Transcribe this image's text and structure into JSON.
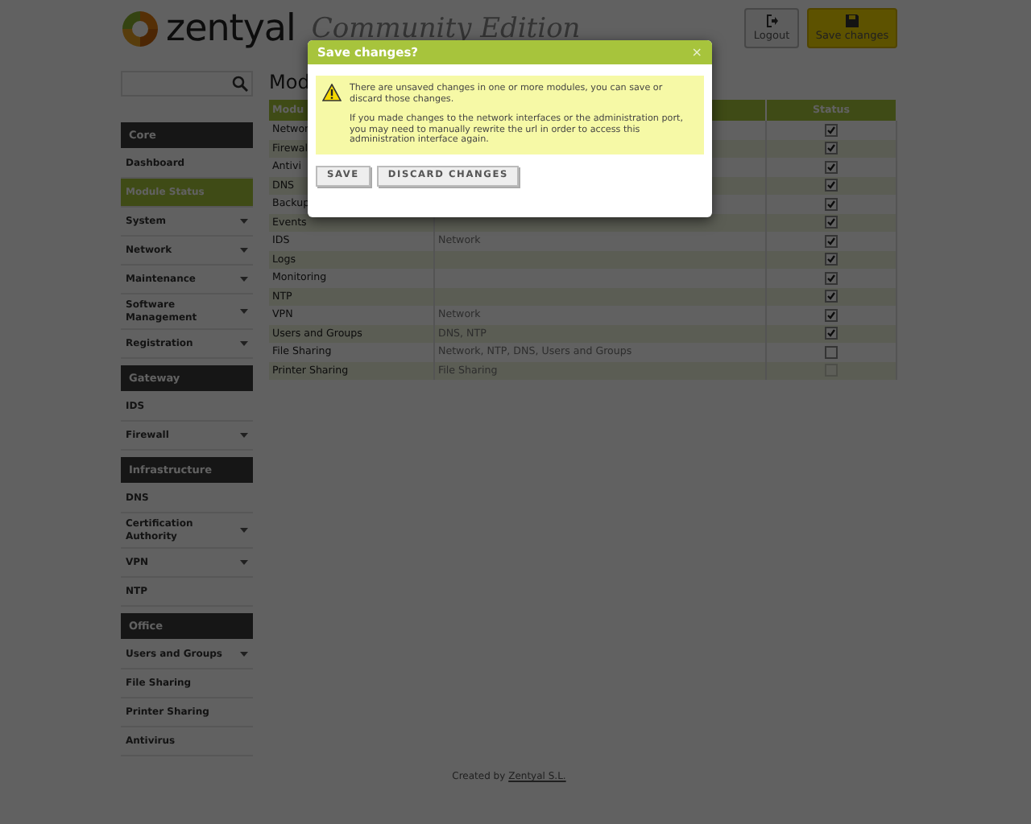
{
  "header": {
    "brand": "zentyal",
    "edition": "Community Edition",
    "buttons": [
      {
        "kind": "logout",
        "label": "Logout",
        "highlighted": false
      },
      {
        "kind": "save",
        "label": "Save changes",
        "highlighted": true
      }
    ]
  },
  "sidebar": {
    "items": [
      {
        "kind": "section",
        "label": "Core"
      },
      {
        "kind": "item",
        "label": "Dashboard",
        "selected": false,
        "expandable": false
      },
      {
        "kind": "item",
        "label": "Module Status",
        "selected": true,
        "expandable": false
      },
      {
        "kind": "item",
        "label": "System",
        "selected": false,
        "expandable": true
      },
      {
        "kind": "item",
        "label": "Network",
        "selected": false,
        "expandable": true
      },
      {
        "kind": "item",
        "label": "Maintenance",
        "selected": false,
        "expandable": true
      },
      {
        "kind": "item",
        "label": "Software Management",
        "selected": false,
        "expandable": true
      },
      {
        "kind": "item",
        "label": "Registration",
        "selected": false,
        "expandable": true
      },
      {
        "kind": "section",
        "label": "Gateway"
      },
      {
        "kind": "item",
        "label": "IDS",
        "selected": false,
        "expandable": false
      },
      {
        "kind": "item",
        "label": "Firewall",
        "selected": false,
        "expandable": true
      },
      {
        "kind": "section",
        "label": "Infrastructure"
      },
      {
        "kind": "item",
        "label": "DNS",
        "selected": false,
        "expandable": false
      },
      {
        "kind": "item",
        "label": "Certification Authority",
        "selected": false,
        "expandable": true
      },
      {
        "kind": "item",
        "label": "VPN",
        "selected": false,
        "expandable": true
      },
      {
        "kind": "item",
        "label": "NTP",
        "selected": false,
        "expandable": false
      },
      {
        "kind": "section",
        "label": "Office"
      },
      {
        "kind": "item",
        "label": "Users and Groups",
        "selected": false,
        "expandable": true
      },
      {
        "kind": "item",
        "label": "File Sharing",
        "selected": false,
        "expandable": false
      },
      {
        "kind": "item",
        "label": "Printer Sharing",
        "selected": false,
        "expandable": false
      },
      {
        "kind": "item",
        "label": "Antivirus",
        "selected": false,
        "expandable": false
      }
    ]
  },
  "page_title": "Mod",
  "table": {
    "columns": [
      "Modu",
      "",
      "Status"
    ],
    "rows": [
      {
        "module": "Networ",
        "depends": "",
        "checked": true,
        "disabled": false
      },
      {
        "module": "Firewal",
        "depends": "",
        "checked": true,
        "disabled": false
      },
      {
        "module": "Antivi",
        "depends": "",
        "checked": true,
        "disabled": false
      },
      {
        "module": "DNS",
        "depends": "",
        "checked": true,
        "disabled": false
      },
      {
        "module": "Backup",
        "depends": "",
        "checked": true,
        "disabled": false
      },
      {
        "module": "Events",
        "depends": "",
        "checked": true,
        "disabled": false
      },
      {
        "module": "IDS",
        "depends": "Network",
        "checked": true,
        "disabled": false
      },
      {
        "module": "Logs",
        "depends": "",
        "checked": true,
        "disabled": false
      },
      {
        "module": "Monitoring",
        "depends": "",
        "checked": true,
        "disabled": false
      },
      {
        "module": "NTP",
        "depends": "",
        "checked": true,
        "disabled": false
      },
      {
        "module": "VPN",
        "depends": "Network",
        "checked": true,
        "disabled": false
      },
      {
        "module": "Users and Groups",
        "depends": "DNS, NTP",
        "checked": true,
        "disabled": false
      },
      {
        "module": "File Sharing",
        "depends": "Network, NTP, DNS, Users and Groups",
        "checked": false,
        "disabled": false
      },
      {
        "module": "Printer Sharing",
        "depends": "File Sharing",
        "checked": false,
        "disabled": true
      }
    ]
  },
  "footer": {
    "text": "Created by",
    "link": "Zentyal S.L."
  },
  "dialog": {
    "title": "Save changes?",
    "close": "×",
    "messages": [
      "There are unsaved changes in one or more modules, you can save or discard those changes.",
      "If you made changes to the network interfaces or the administration port, you may need to manually rewrite the url in order to access this administration interface again."
    ],
    "buttons": [
      "SAVE",
      "DISCARD CHANGES"
    ]
  }
}
